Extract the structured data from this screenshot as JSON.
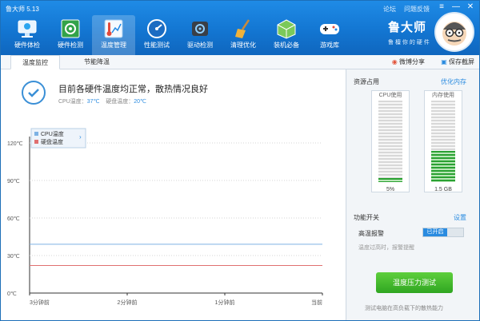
{
  "window": {
    "title": "鲁大师 5.13"
  },
  "system_links": [
    "论坛",
    "问题反馈"
  ],
  "window_controls": {
    "menu": "≡",
    "minimize": "—",
    "close": "✕"
  },
  "nav": [
    {
      "label": "硬件体检",
      "icon": "monitor-check-icon"
    },
    {
      "label": "硬件检测",
      "icon": "circuit-board-icon"
    },
    {
      "label": "温度管理",
      "icon": "thermometer-icon",
      "active": true
    },
    {
      "label": "性能测试",
      "icon": "speedometer-icon"
    },
    {
      "label": "驱动检测",
      "icon": "driver-gear-icon"
    },
    {
      "label": "清理优化",
      "icon": "broom-icon"
    },
    {
      "label": "装机必备",
      "icon": "package-cube-icon"
    },
    {
      "label": "游戏库",
      "icon": "gamepad-icon"
    }
  ],
  "brand": {
    "name": "鲁大师",
    "slogan": "鲁 檀 你 的 硬 件"
  },
  "tabs": [
    {
      "label": "温度监控",
      "active": true
    },
    {
      "label": "节能降温",
      "active": false
    }
  ],
  "tab_actions": {
    "share": "微博分享",
    "screenshot": "保存截屏"
  },
  "status": {
    "title": "目前各硬件温度均正常，散热情况良好",
    "cpu_label": "CPU温度：",
    "cpu_value": "37℃",
    "disk_label": "硬盘温度：",
    "disk_value": "20℃"
  },
  "chart_data": {
    "type": "line",
    "title": "",
    "xlabel": "",
    "ylabel": "",
    "x_ticks": [
      "3分钟前",
      "2分钟前",
      "1分钟前",
      "当前"
    ],
    "y_ticks": [
      "0℃",
      "30℃",
      "60℃",
      "90℃",
      "120℃"
    ],
    "ylim": [
      0,
      120
    ],
    "series": [
      {
        "name": "CPU温度",
        "color": "#7eb2e4",
        "values": [
          39,
          39,
          39,
          39
        ]
      },
      {
        "name": "硬盘温度",
        "color": "#e07070",
        "values": [
          22,
          22,
          22,
          22
        ]
      }
    ],
    "legend": "top-left",
    "grid": false
  },
  "side": {
    "resources_title": "资源占用",
    "optimize_link": "优化内存",
    "cpu": {
      "label": "CPU使用",
      "value": "5%",
      "fraction": 0.05
    },
    "memory": {
      "label": "内存使用",
      "value": "1.5 GB",
      "fraction": 0.38
    },
    "features_title": "功能开关",
    "settings_link": "设置",
    "alarm_label": "高温报警",
    "alarm_state": "已开启",
    "alarm_hint": "温度过高时，报警提醒",
    "action_button": "温度压力测试",
    "footer_hint": "测试电脑在高负载下的散热能力"
  },
  "colors": {
    "accent": "#1376d2",
    "active_tab": "#2a8be0",
    "ok_green": "#2aa132"
  }
}
